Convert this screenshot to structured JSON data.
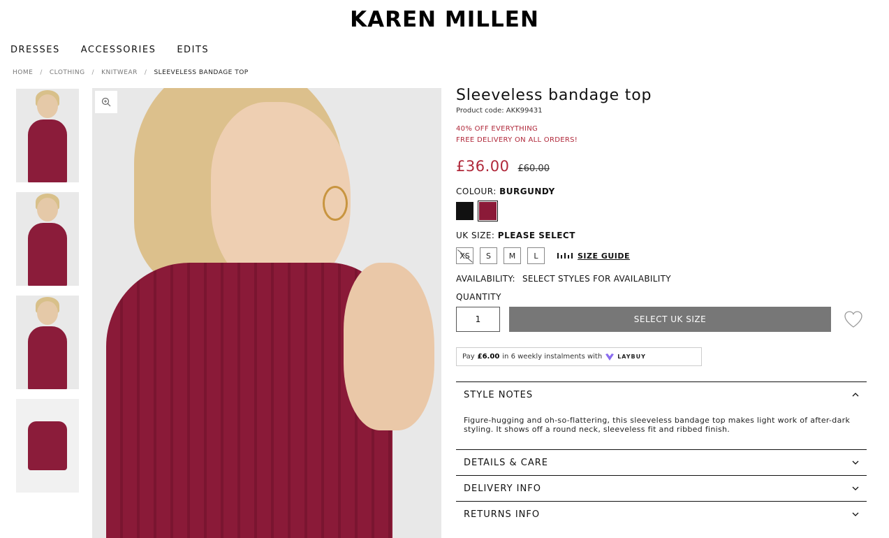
{
  "header": {
    "logo": "KAREN MILLEN"
  },
  "nav": {
    "items": [
      "DRESSES",
      "ACCESSORIES",
      "EDITS"
    ]
  },
  "breadcrumb": {
    "items": [
      "HOME",
      "CLOTHING",
      "KNITWEAR",
      "SLEEVELESS BANDAGE TOP"
    ],
    "separator": "/"
  },
  "product": {
    "title": "Sleeveless bandage top",
    "code": "Product code: AKK99431",
    "promo_1": "40% OFF EVERYTHING",
    "promo_2": "FREE DELIVERY ON ALL ORDERS!",
    "price": "£36.00",
    "was_price": "£60.00",
    "colour_label": "COLOUR:",
    "colour_value": "BURGUNDY",
    "colours": [
      {
        "name": "Black",
        "hex": "#111111"
      },
      {
        "name": "Burgundy",
        "hex": "#8b1a38",
        "selected": true
      }
    ],
    "size_label": "UK SIZE:",
    "size_value": "PLEASE SELECT",
    "sizes": [
      {
        "label": "XS",
        "available": false
      },
      {
        "label": "S",
        "available": true
      },
      {
        "label": "M",
        "available": true
      },
      {
        "label": "L",
        "available": true
      }
    ],
    "size_guide": "SIZE GUIDE",
    "availability_label": "AVAILABILITY:",
    "availability_value": "SELECT STYLES FOR AVAILABILITY",
    "quantity_label": "QUANTITY",
    "quantity": "1",
    "add_button": "SELECT UK SIZE",
    "laybuy": {
      "pay": "Pay",
      "amount": "£6.00",
      "text": "in 6 weekly instalments with",
      "brand": "LAYBUY"
    }
  },
  "accordion": [
    {
      "title": "STYLE NOTES",
      "open": true,
      "body": "Figure-hugging and oh-so-flattering, this sleeveless bandage top makes light work of after-dark styling. It shows off a round neck, sleeveless fit and ribbed finish."
    },
    {
      "title": "DETAILS & CARE",
      "open": false
    },
    {
      "title": "DELIVERY INFO",
      "open": false
    },
    {
      "title": "RETURNS INFO",
      "open": false
    }
  ],
  "colors": {
    "accent": "#b0283a",
    "product": "#8b1a38",
    "button": "#777777"
  }
}
